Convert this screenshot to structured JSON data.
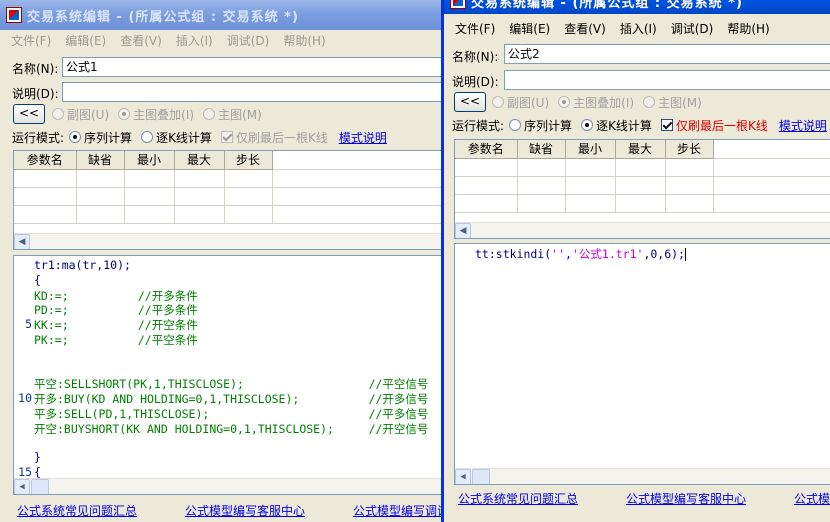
{
  "window1": {
    "title": "交易系统编辑 - (所属公式组 : 交易系统 *)",
    "menu": [
      "文件(F)",
      "编辑(E)",
      "查看(V)",
      "插入(I)",
      "调试(D)",
      "帮助(H)"
    ],
    "name_label": "名称(N):",
    "name_value": "公式1",
    "desc_label": "说明(D):",
    "desc_value": "",
    "collapse_button": "<<",
    "chart_options": [
      "副图(U)",
      "主图叠加(I)",
      "主图(M)"
    ],
    "mode_label": "运行模式:",
    "mode_options": [
      "序列计算",
      "逐K线计算"
    ],
    "last_bar_only": "仅刷最后一根K线",
    "mode_help": "模式说明",
    "param_headers": [
      "参数名",
      "缺省",
      "最小",
      "最大",
      "步长"
    ],
    "code_lines": [
      {
        "n": "",
        "t": "tr1:ma(tr,10);"
      },
      {
        "n": "",
        "t": "{"
      },
      {
        "n": "",
        "t": "KD:=;          //开多条件"
      },
      {
        "n": "",
        "t": "PD:=;          //平多条件"
      },
      {
        "n": "5",
        "t": "KK:=;          //开空条件"
      },
      {
        "n": "",
        "t": "PK:=;          //平空条件"
      },
      {
        "n": "",
        "t": ""
      },
      {
        "n": "",
        "t": ""
      },
      {
        "n": "",
        "t": "平空:SELLSHORT(PK,1,THISCLOSE);                  //平空信号"
      },
      {
        "n": "10",
        "t": "开多:BUY(KD AND HOLDING=0,1,THISCLOSE);          //开多信号"
      },
      {
        "n": "",
        "t": "平多:SELL(PD,1,THISCLOSE);                       //平多信号"
      },
      {
        "n": "",
        "t": "开空:BUYSHORT(KK AND HOLDING=0,1,THISCLOSE);     //开空信号"
      },
      {
        "n": "",
        "t": ""
      },
      {
        "n": "",
        "t": "}"
      },
      {
        "n": "15",
        "t": "{"
      }
    ],
    "footer_links": [
      "公式系统常见问题汇总",
      "公式模型编写客服中心",
      "公式模型编写调试教程"
    ]
  },
  "window2": {
    "title": "交易系统编辑 - (所属公式组 : 交易系统 *)",
    "menu": [
      "文件(F)",
      "编辑(E)",
      "查看(V)",
      "插入(I)",
      "调试(D)",
      "帮助(H)"
    ],
    "name_label": "名称(N):",
    "name_value": "公式2",
    "desc_label": "说明(D):",
    "desc_value": "",
    "collapse_button": "<<",
    "chart_options": [
      "副图(U)",
      "主图叠加(I)",
      "主图(M)"
    ],
    "mode_label": "运行模式:",
    "mode_options": [
      "序列计算",
      "逐K线计算"
    ],
    "last_bar_only": "仅刷最后一根K线",
    "mode_help": "模式说明",
    "param_headers": [
      "参数名",
      "缺省",
      "最小",
      "最大",
      "步长"
    ],
    "code": {
      "prefix": "tt:stkindi(",
      "arg1": "''",
      "sep": ",",
      "arg2": "'公式1.tr1'",
      "suffix": ",0,6);"
    },
    "footer_links": [
      "公式系统常见问题汇总",
      "公式模型编写客服中心",
      "公式模型编写调试教程"
    ]
  },
  "colors": {
    "active_title": "#0054e3",
    "inactive_title": "#7b9ee0",
    "link": "#0000ee",
    "warning_text": "#e00000",
    "code_string": "#cc00cc",
    "code_comment": "#008000"
  }
}
